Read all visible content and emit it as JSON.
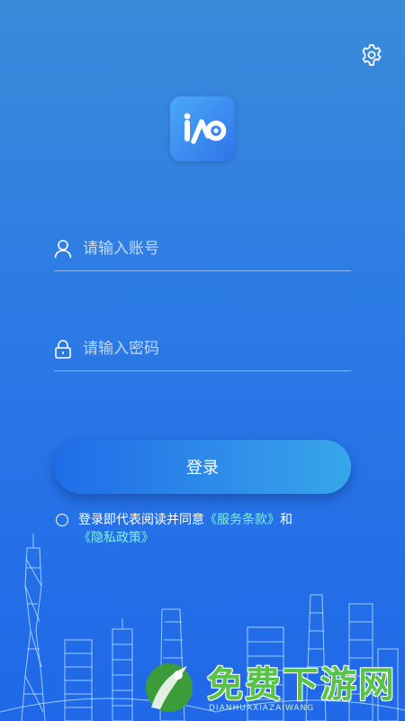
{
  "header": {
    "settings_icon": "gear-icon"
  },
  "logo": {
    "icon": "app-logo",
    "accent_color": "#2f74e9"
  },
  "form": {
    "account": {
      "icon": "user-icon",
      "placeholder": "请输入账号",
      "value": ""
    },
    "password": {
      "icon": "lock-icon",
      "placeholder": "请输入密码",
      "value": ""
    },
    "login_label": "登录"
  },
  "agreement": {
    "prefix": "登录即代表阅读并同意",
    "terms_link": "《服务条款》",
    "conjunction": "和",
    "privacy_link": "《隐私政策》",
    "checked": false,
    "link_color": "#7ff0e6"
  },
  "watermark": {
    "title": "免费下游网",
    "subtitle": "DIANHUAXIAZAIWANG"
  }
}
